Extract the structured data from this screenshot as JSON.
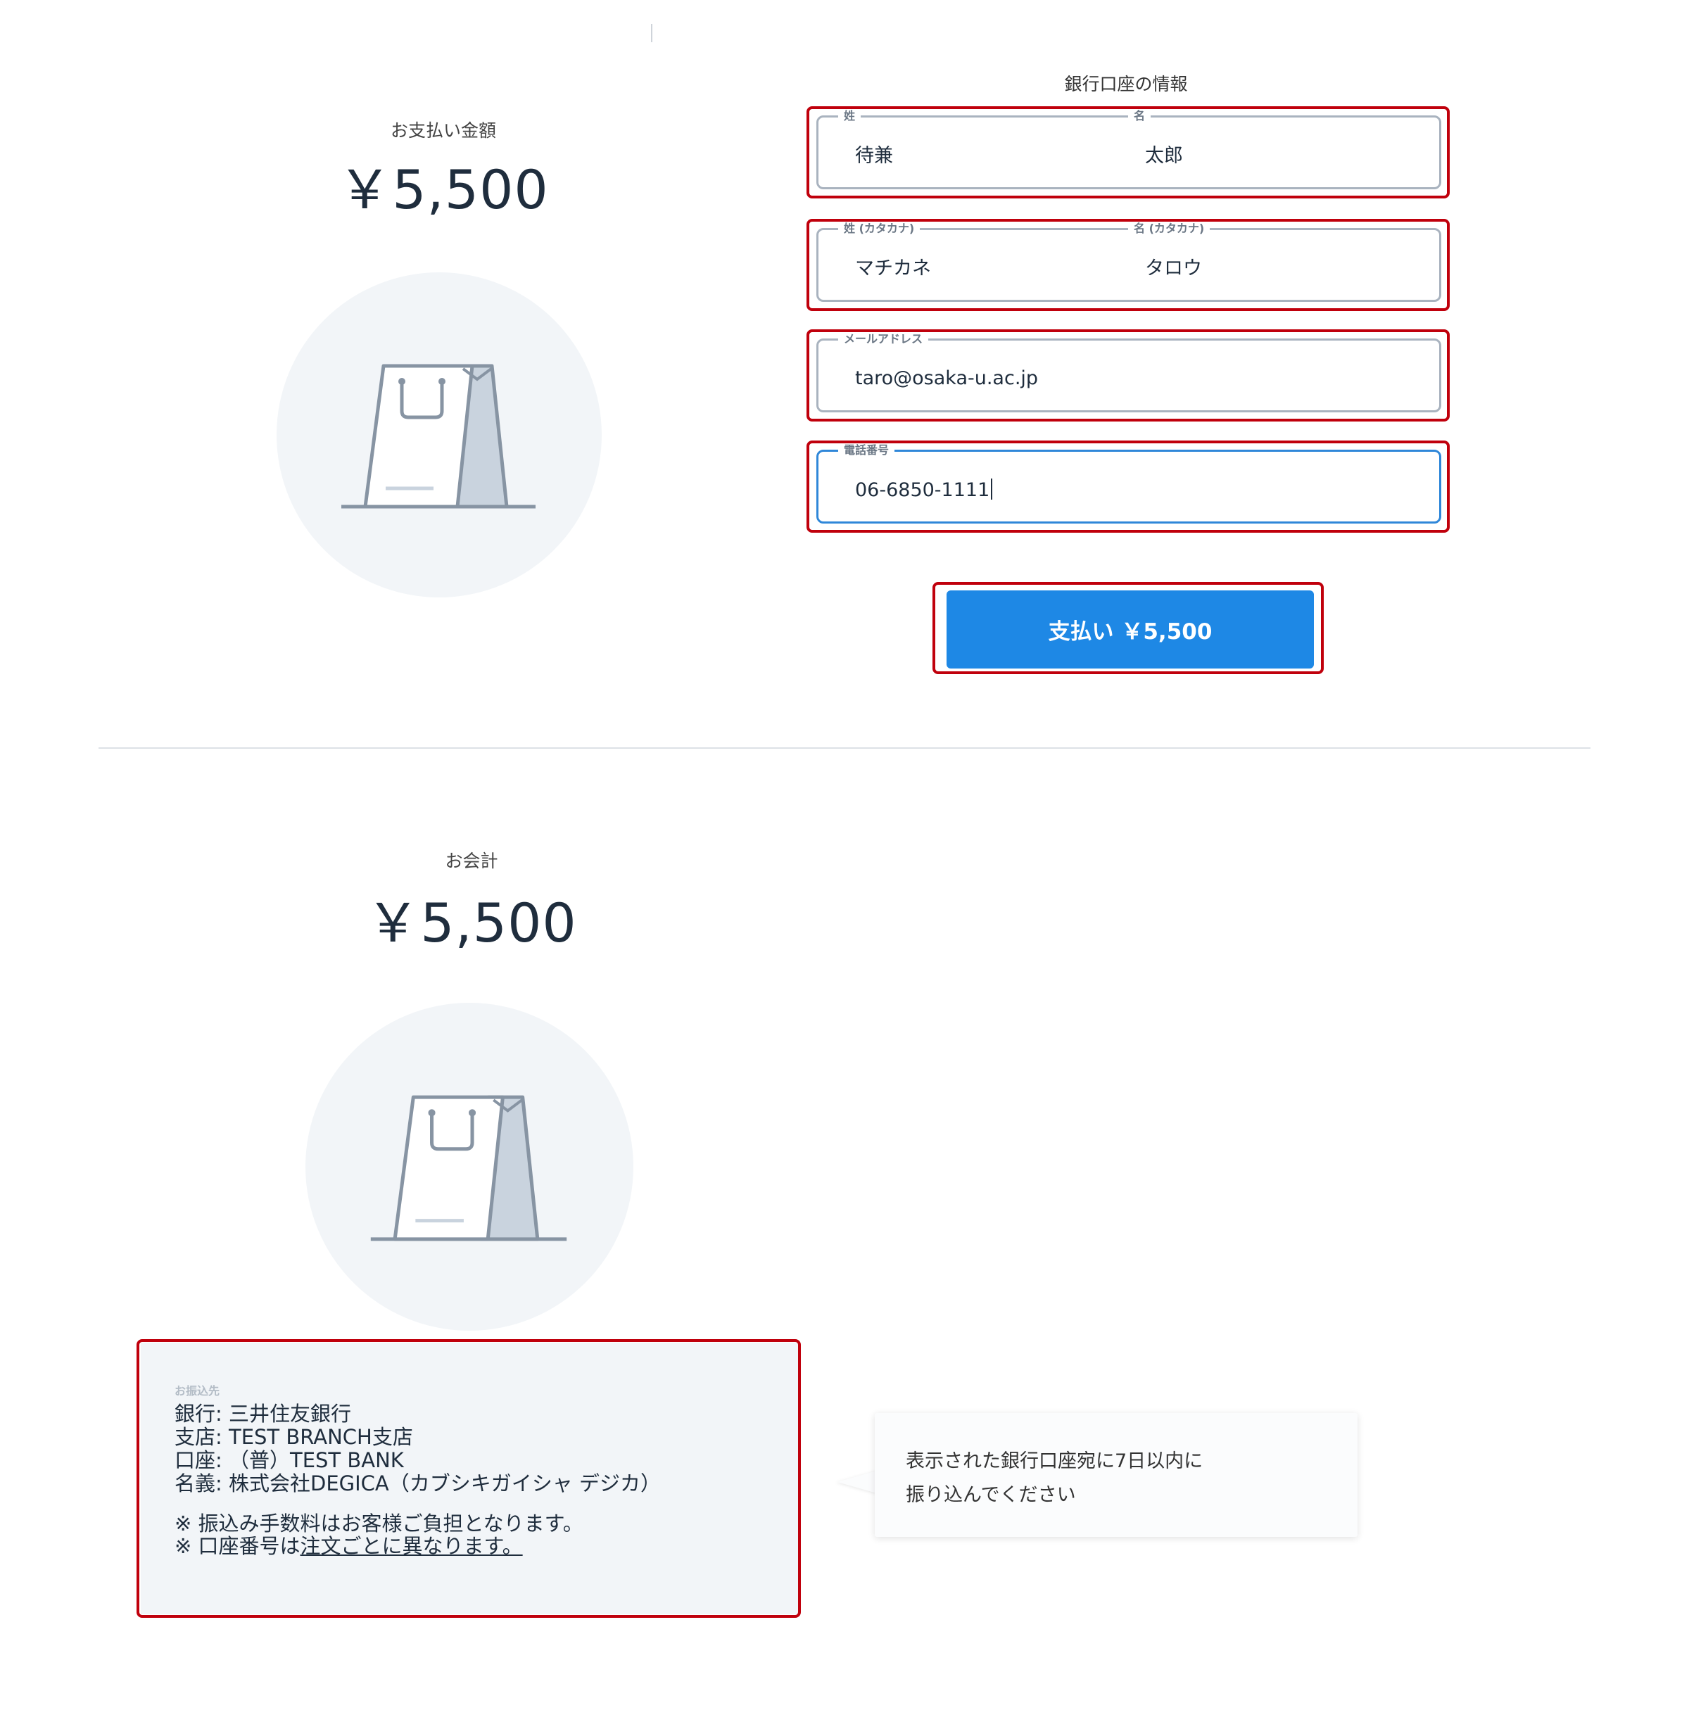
{
  "payment": {
    "amount_label": "お支払い金額",
    "amount": "￥5,500"
  },
  "bank_form": {
    "title": "銀行口座の情報",
    "last_name_label": "姓",
    "first_name_label": "名",
    "last_name": "待兼",
    "first_name": "太郎",
    "last_name_kana_label": "姓 (カタカナ)",
    "first_name_kana_label": "名 (カタカナ)",
    "last_name_kana": "マチカネ",
    "first_name_kana": "タロウ",
    "email_label": "メールアドレス",
    "email": "taro@osaka-u.ac.jp",
    "phone_label": "電話番号",
    "phone": "06-6850-1111",
    "pay_button": "支払い ￥5,500"
  },
  "checkout": {
    "label": "お会計",
    "amount": "￥5,500"
  },
  "transfer_info": {
    "heading": "お振込先",
    "bank": "銀行: 三井住友銀行",
    "branch": "支店: TEST BRANCH支店",
    "account": "口座: （普）TEST BANK",
    "holder": "名義: 株式会社DEGICA（カブシキガイシャ デジカ）",
    "note1": "※ 振込み手数料はお客様ご負担となります。",
    "note2_prefix": "※ 口座番号は",
    "note2_link": "注文ごとに異なります。"
  },
  "tooltip": {
    "line1": "表示された銀行口座宛に7日以内に",
    "line2": "振り込んでください"
  },
  "icons": [
    "shopping-bag-icon"
  ],
  "colors": {
    "accent": "#1e88e5",
    "highlight_border": "#c0000c",
    "field_border": "#a9b3bf",
    "focus_border": "#2f87d9",
    "panel_bg": "#f2f5f8"
  }
}
